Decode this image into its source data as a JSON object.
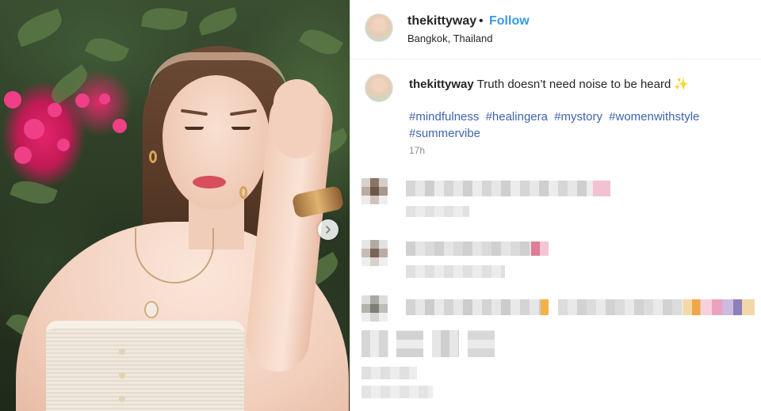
{
  "post": {
    "username": "thekittyway",
    "separator": "•",
    "follow_label": "Follow",
    "location": "Bangkok, Thailand"
  },
  "caption": {
    "username": "thekittyway",
    "text": "Truth doesn’t need noise to be heard",
    "emoji": "✨",
    "hashtags": [
      "#mindfulness",
      "#healingera",
      "#mystory",
      "#womenwithstyle",
      "#summervibe"
    ],
    "time": "17h"
  },
  "icons": {
    "carousel_next": "chevron-right-icon",
    "sparkle": "sparkles-emoji"
  },
  "colors": {
    "follow_blue": "#3897f0",
    "hashtag_blue": "#3d64b0",
    "muted_gray": "#8e8e8e",
    "divider": "#dbdbdb"
  }
}
